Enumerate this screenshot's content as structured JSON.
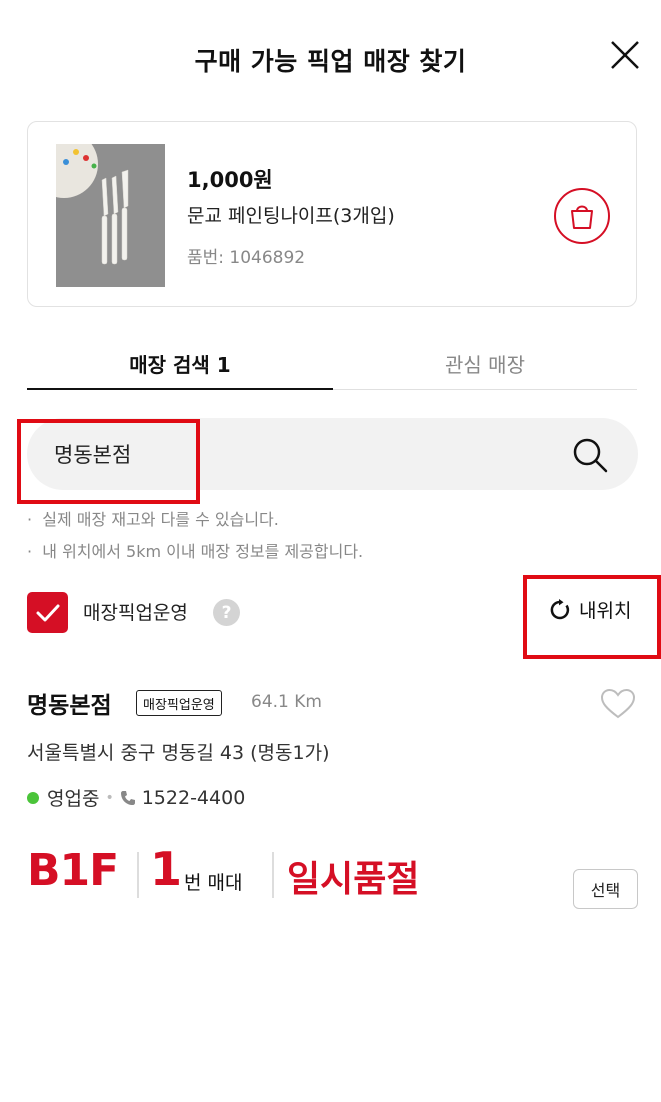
{
  "header": {
    "title": "구매 가능 픽업 매장 찾기",
    "close_icon": "close-icon"
  },
  "product": {
    "price": "1,000원",
    "name": "문교 페인팅나이프(3개입)",
    "code": "품번: 1046892",
    "cart_icon": "shopping-bag-icon"
  },
  "tabs": [
    {
      "label": "매장 검색 1",
      "active": true
    },
    {
      "label": "관심 매장",
      "active": false
    }
  ],
  "search": {
    "value": "명동본점",
    "icon": "search-icon"
  },
  "notes": [
    "실제 매장 재고와 다를 수 있습니다.",
    "내 위치에서 5km 이내 매장 정보를 제공합니다."
  ],
  "filter": {
    "checkbox_label": "매장픽업운영",
    "checked": true,
    "help_label": "?",
    "my_location_label": "내위치"
  },
  "store": {
    "name": "명동본점",
    "tag": "매장픽업운영",
    "distance": "64.1 Km",
    "address": "서울특별시 중구 명동길 43 (명동1가)",
    "status": "영업중",
    "phone": "1522-4400",
    "floor": "B1F",
    "shelf_number": "1",
    "shelf_unit": "번 매대",
    "stock_status": "일시품절",
    "select_label": "선택"
  },
  "colors": {
    "accent": "#d50f25",
    "highlight": "#e00b14",
    "open_status": "#4bc43a"
  }
}
